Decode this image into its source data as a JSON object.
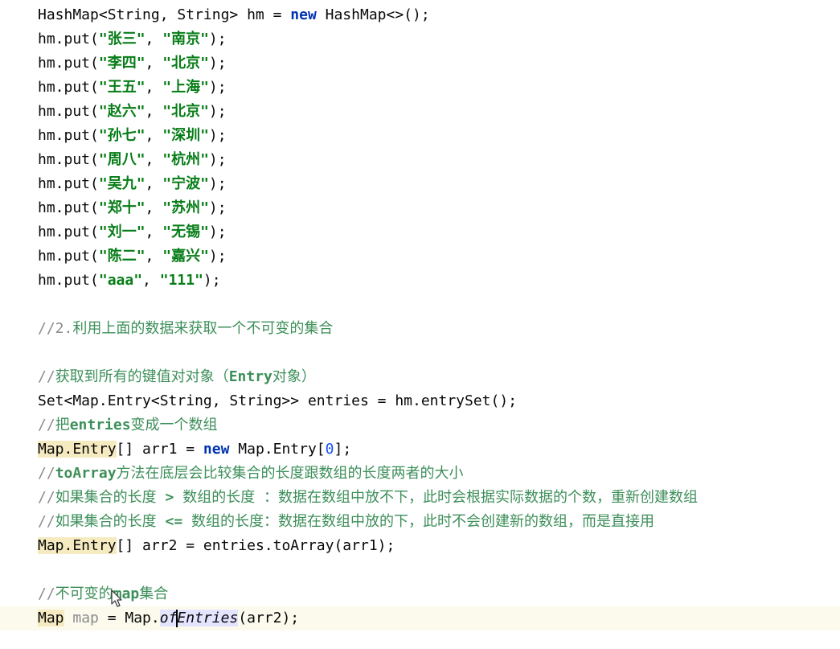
{
  "code": {
    "l01_a": "HashMap<String, String> hm = ",
    "l01_new": "new",
    "l01_b": " HashMap<>();",
    "put_prefix": "hm.put(",
    "comma": ", ",
    "put_suffix": ");",
    "puts": [
      {
        "k": "\"张三\"",
        "v": "\"南京\""
      },
      {
        "k": "\"李四\"",
        "v": "\"北京\""
      },
      {
        "k": "\"王五\"",
        "v": "\"上海\""
      },
      {
        "k": "\"赵六\"",
        "v": "\"北京\""
      },
      {
        "k": "\"孙七\"",
        "v": "\"深圳\""
      },
      {
        "k": "\"周八\"",
        "v": "\"杭州\""
      },
      {
        "k": "\"吴九\"",
        "v": "\"宁波\""
      },
      {
        "k": "\"郑十\"",
        "v": "\"苏州\""
      },
      {
        "k": "\"刘一\"",
        "v": "\"无锡\""
      },
      {
        "k": "\"陈二\"",
        "v": "\"嘉兴\""
      },
      {
        "k": "\"aaa\"",
        "v": "\"111\""
      }
    ],
    "c2_slash": "//2.",
    "c2_text": "利用上面的数据来获取一个不可变的集合",
    "c3_slash": "//",
    "c3_a": "获取到所有的键值对对象（",
    "c3_kw": "Entry",
    "c3_b": "对象）",
    "l_set": "Set<Map.Entry<String, String>> entries = hm.entrySet();",
    "c4_slash": "//",
    "c4_a": "把",
    "c4_kw": "entries",
    "c4_b": "变成一个数组",
    "l_arr1_type": "Map.Entry",
    "l_arr1_a": "[] arr1 = ",
    "l_arr1_new": "new",
    "l_arr1_b": " Map.Entry[",
    "l_arr1_num": "0",
    "l_arr1_c": "];",
    "c5_slash": "//",
    "c5_kw": "toArray",
    "c5_text": "方法在底层会比较集合的长度跟数组的长度两者的大小",
    "c6_slash": "//",
    "c6_a": "如果集合的长度 ",
    "c6_kw": ">",
    "c6_b": " 数组的长度 ：数据在数组中放不下，此时会根据实际数据的个数，重新创建数组",
    "c7_slash": "//",
    "c7_a": "如果集合的长度 ",
    "c7_kw": "<=",
    "c7_b": " 数组的长度：数据在数组中放的下，此时不会创建新的数组，而是直接用",
    "l_arr2_type": "Map.Entry",
    "l_arr2_rest": "[] arr2 = entries.toArray(arr1);",
    "c8_slash": "//",
    "c8_a": "不可变的",
    "c8_kw": "map",
    "c8_b": "集合",
    "l_map_type": "Map",
    "l_map_sp": " ",
    "l_map_var": "map",
    "l_map_mid": " = Map.",
    "l_map_of": "of",
    "l_map_entries": "Entries",
    "l_map_end": "(arr2);"
  },
  "colors": {
    "string": "#067d17",
    "keyword": "#0033b3",
    "number": "#1750eb",
    "comment": "#8c8c8c",
    "comment_text": "#3d8f5a",
    "type_highlight": "#f5eac0",
    "current_line": "#fcfaed",
    "selection": "#e4e4ff"
  },
  "icons": {
    "mouse": "mouse-pointer-icon"
  }
}
